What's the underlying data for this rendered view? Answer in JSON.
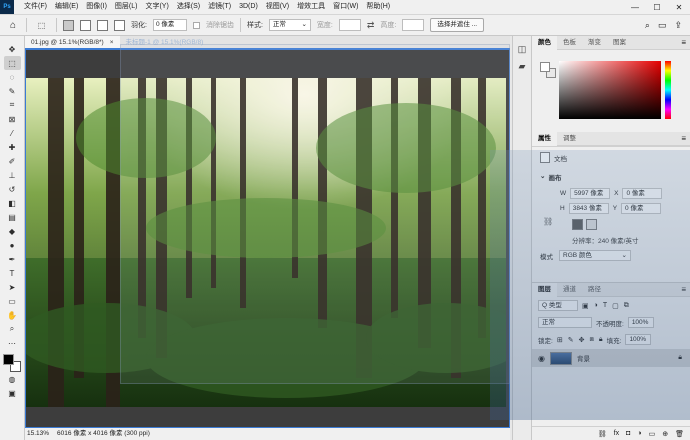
{
  "app": {
    "logo_text": "Ps"
  },
  "menu": [
    "文件(F)",
    "编辑(E)",
    "图像(I)",
    "图层(L)",
    "文字(Y)",
    "选择(S)",
    "滤镜(T)",
    "3D(D)",
    "视图(V)",
    "增效工具",
    "窗口(W)",
    "帮助(H)"
  ],
  "window_controls": {
    "minimize": "—",
    "restore": "☐",
    "close": "✕"
  },
  "options_bar": {
    "feather_label": "羽化:",
    "feather_value": "0 像素",
    "antialias_label": "消除锯齿",
    "style_label": "样式:",
    "style_value": "正常",
    "width_label": "宽度:",
    "height_label": "高度:",
    "select_subject_button": "选择并遮住 ..."
  },
  "document": {
    "tab_title": "01.jpg @ 15.1%(RGB/8*)",
    "tab_close": "×",
    "ghost_tab_title": "未标题-1 @ 15.1%(RGB/8)",
    "zoom": "15.13%",
    "dimensions": "6016 像素 x 4016 像素 (300 ppi)"
  },
  "color_panel": {
    "tabs": [
      "颜色",
      "色板",
      "渐变",
      "图案"
    ],
    "accent": "#e60000"
  },
  "properties_panel": {
    "tabs": [
      "属性",
      "调整"
    ],
    "doc_label": "文档",
    "canvas_title": "画布",
    "w_label": "W",
    "w_value": "5997 像素",
    "x_label": "X",
    "x_value": "0 像素",
    "h_label": "H",
    "h_value": "3843 像素",
    "y_label": "Y",
    "y_value": "0 像素",
    "resolution": "分辨率：240 像素/英寸",
    "mode_label": "模式",
    "mode_value": "RGB 颜色"
  },
  "layers_panel": {
    "tabs": [
      "图层",
      "通道",
      "路径"
    ],
    "kind_filter": "Q 类型",
    "blend_mode": "正常",
    "opacity_label": "不透明度:",
    "opacity_value": "100%",
    "lock_label": "锁定:",
    "fill_label": "填充:",
    "fill_value": "100%",
    "layer_name": "背景"
  }
}
